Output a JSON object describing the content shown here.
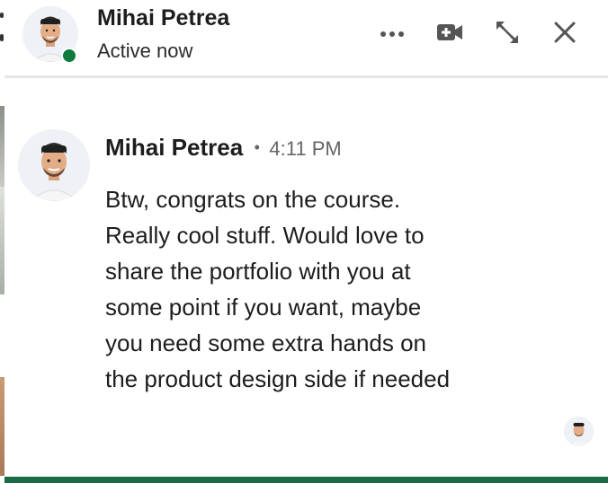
{
  "header": {
    "name": "Mihai Petrea",
    "status": "Active now",
    "presence_color": "#0f7b3d",
    "icons": {
      "more": "more-horizontal-icon",
      "video": "video-call-icon",
      "expand": "expand-icon",
      "close": "close-icon"
    }
  },
  "message": {
    "sender": "Mihai Petrea",
    "separator": "•",
    "time": "4:11 PM",
    "lines": [
      "Btw, congrats on the course.",
      "Really cool stuff. Would love to",
      "share the portfolio with you at",
      "some point if you want, maybe",
      "you need some extra hands on",
      "the product design side if needed"
    ]
  },
  "colors": {
    "accent_green": "#1a6b43",
    "text": "#1d1d1d",
    "muted": "#666666"
  }
}
